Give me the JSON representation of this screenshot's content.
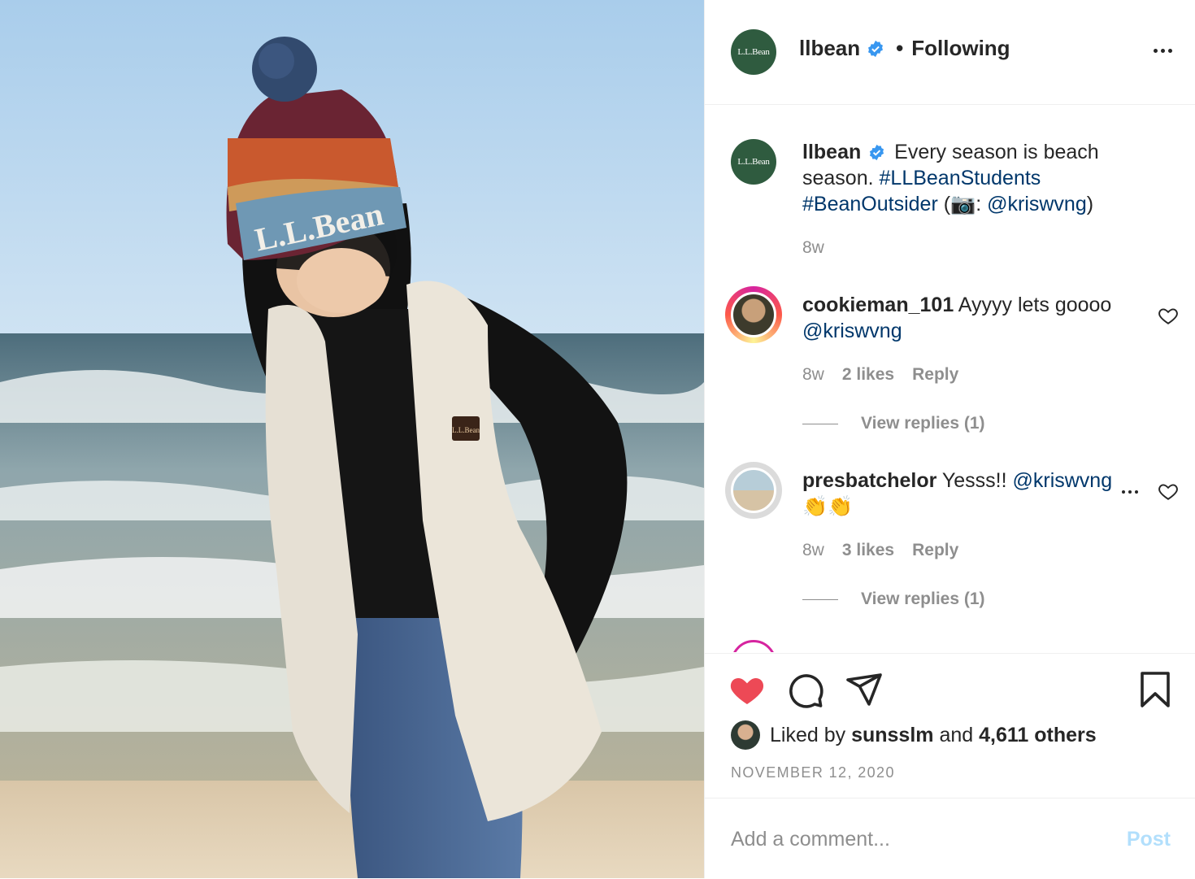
{
  "header": {
    "username": "llbean",
    "follow_status": "Following",
    "brand_avatar_text": "L.L.Bean"
  },
  "photo": {
    "hat_text": "L.L.Bean",
    "patch_text": "L.L.Bean"
  },
  "caption": {
    "username": "llbean",
    "text_1": "Every season is beach season.",
    "hashtag_1": "#LLBeanStudents",
    "hashtag_2": "#BeanOutsider",
    "open": "(",
    "camera": "📷",
    "colon": ":",
    "mention": "@kriswvng",
    "close": ")",
    "time": "8w"
  },
  "comments": [
    {
      "username": "cookieman_101",
      "text": "Ayyyy lets goooo",
      "mention": "@kriswvng",
      "time": "8w",
      "likes": "2 likes",
      "reply": "Reply",
      "view_replies": "View replies (1)"
    },
    {
      "username": "presbatchelor",
      "text": "Yesss!!",
      "mention": "@kriswvng",
      "emoji": "👏👏",
      "time": "8w",
      "likes": "3 likes",
      "reply": "Reply",
      "view_replies": "View replies (1)"
    }
  ],
  "likes": {
    "prefix": "Liked by",
    "user": "sunsslm",
    "and": "and",
    "others": "4,611 others"
  },
  "date": "NOVEMBER 12, 2020",
  "add_comment": {
    "placeholder": "Add a comment...",
    "post_label": "Post"
  },
  "colors": {
    "like_red": "#ed4956",
    "link_blue": "#00376b",
    "verified_blue": "#3897f0",
    "brand_green": "#2f5b3f",
    "muted": "#8e8e8e"
  },
  "icons": [
    "heart-filled-icon",
    "comment-icon",
    "share-icon",
    "bookmark-icon",
    "more-icon",
    "heart-outline-icon",
    "verified-badge-icon"
  ]
}
